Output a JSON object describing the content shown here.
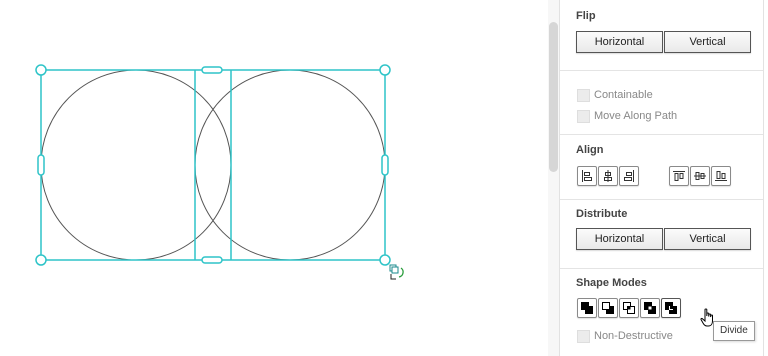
{
  "panel": {
    "flip": {
      "title": "Flip",
      "horizontal_label": "Horizontal",
      "vertical_label": "Vertical"
    },
    "options": {
      "containable_label": "Containable",
      "move_along_path_label": "Move Along Path"
    },
    "align": {
      "title": "Align",
      "icons": [
        "align-left-icon",
        "align-center-horizontal-icon",
        "align-right-icon",
        "align-top-icon",
        "align-middle-vertical-icon",
        "align-bottom-icon"
      ]
    },
    "distribute": {
      "title": "Distribute",
      "horizontal_label": "Horizontal",
      "vertical_label": "Vertical"
    },
    "shape_modes": {
      "title": "Shape Modes",
      "icons": [
        "unite-icon",
        "subtract-icon",
        "intersect-icon",
        "exclude-icon",
        "divide-icon"
      ],
      "non_destructive_label": "Non-Destructive",
      "tooltip": "Divide"
    }
  },
  "colors": {
    "selection": "#2ec4c8",
    "shape_stroke": "#555555"
  }
}
